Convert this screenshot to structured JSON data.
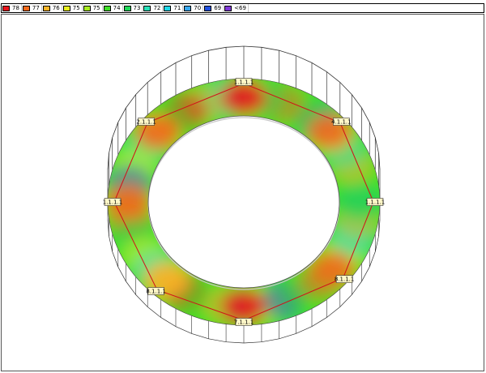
{
  "legend": {
    "items": [
      {
        "label": "78",
        "color": "#e8141c"
      },
      {
        "label": "77",
        "color": "#f46a1c"
      },
      {
        "label": "76",
        "color": "#f8b428"
      },
      {
        "label": "75",
        "color": "#e8f020"
      },
      {
        "label": "75",
        "color": "#a8ec20"
      },
      {
        "label": "74",
        "color": "#40e028"
      },
      {
        "label": "73",
        "color": "#20d858"
      },
      {
        "label": "72",
        "color": "#28e0b8"
      },
      {
        "label": "71",
        "color": "#20d8e8"
      },
      {
        "label": "70",
        "color": "#38a8f0"
      },
      {
        "label": "69",
        "color": "#2050e0"
      },
      {
        "label": "<69",
        "color": "#8038d8"
      }
    ]
  },
  "watermark": "",
  "sensors": [
    {
      "id": "s1",
      "label": "1.1.1.1",
      "angle": 90,
      "value": 78
    },
    {
      "id": "s2",
      "label": "2.1.1.1",
      "angle": 138,
      "value": 77
    },
    {
      "id": "s3",
      "label": "1.1.1.1",
      "angle": 180,
      "value": 77
    },
    {
      "id": "s4",
      "label": "8.1.1.1",
      "angle": 228,
      "value": 76
    },
    {
      "id": "s5",
      "label": "7.1.1.1",
      "angle": 270,
      "value": 78
    },
    {
      "id": "s6",
      "label": "8.1.1.1",
      "angle": 320,
      "value": 77
    },
    {
      "id": "s7",
      "label": "1.1.1.1",
      "angle": 0,
      "value": 73
    },
    {
      "id": "s8",
      "label": "4.1.1.1",
      "angle": 42,
      "value": 77
    }
  ],
  "field_samples": [
    78,
    77,
    76,
    75,
    75,
    76,
    74,
    74,
    73,
    72,
    71,
    69
  ]
}
